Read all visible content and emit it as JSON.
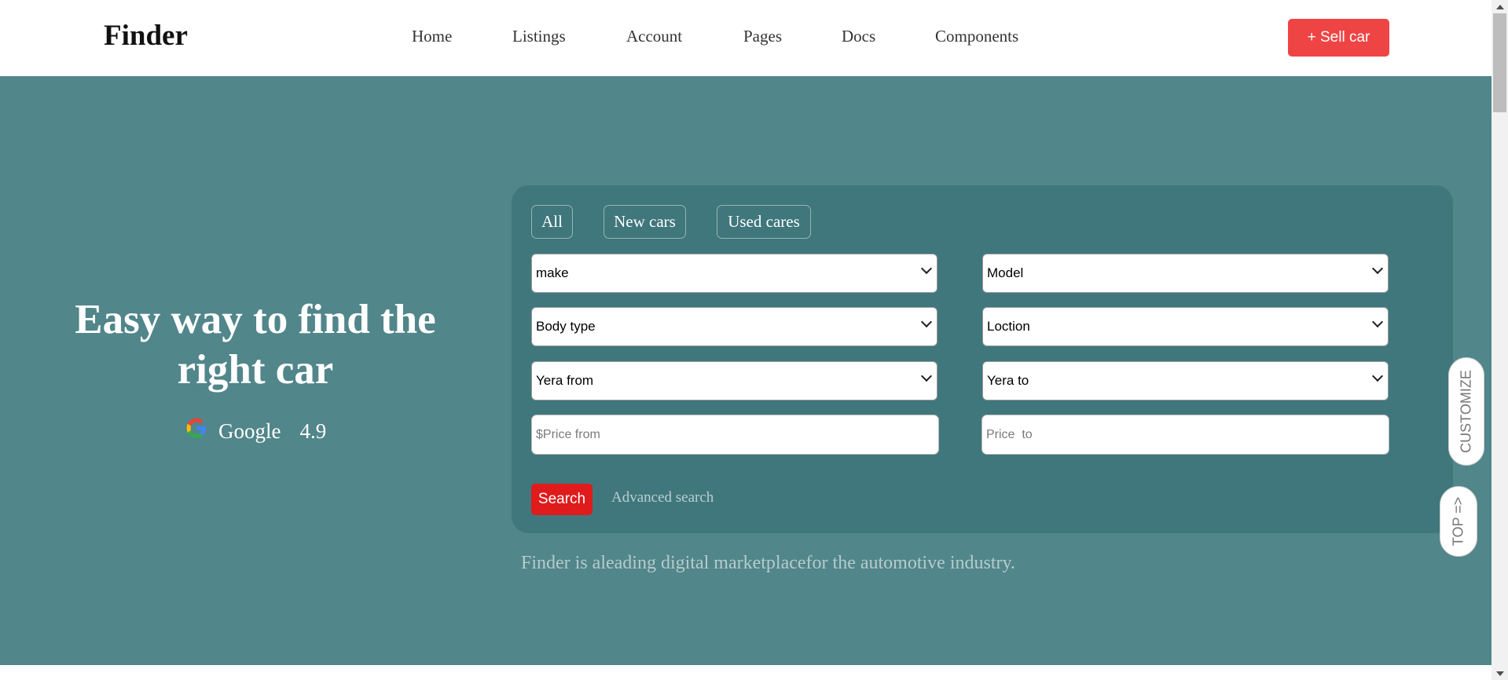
{
  "header": {
    "logo": "Finder",
    "nav": [
      "Home",
      "Listings",
      "Account",
      "Pages",
      "Docs",
      "Components"
    ],
    "sell_button": "+ Sell car"
  },
  "hero": {
    "title": "Easy way to find the right car",
    "rating_source": "Google",
    "rating_value": "4.9",
    "tagline": "Finder is aleading digital marketplacefor the automotive industry."
  },
  "search": {
    "tabs": [
      "All",
      "New cars",
      "Used cares"
    ],
    "make": "make",
    "model": "Model",
    "body_type": "Body type",
    "location": "Loction",
    "year_from": "Yera from",
    "year_to": "Yera to",
    "price_from_placeholder": "$Price from",
    "price_to_placeholder": "Price  to",
    "search_button": "Search",
    "advanced_link": "Advanced search"
  },
  "floating": {
    "customize": "CUSTOMIZE",
    "top": "TOP =>"
  },
  "colors": {
    "hero_bg": "#51868a",
    "panel_bg": "#3f777d",
    "accent_red": "#ef4444",
    "search_red": "#e01b1b"
  }
}
